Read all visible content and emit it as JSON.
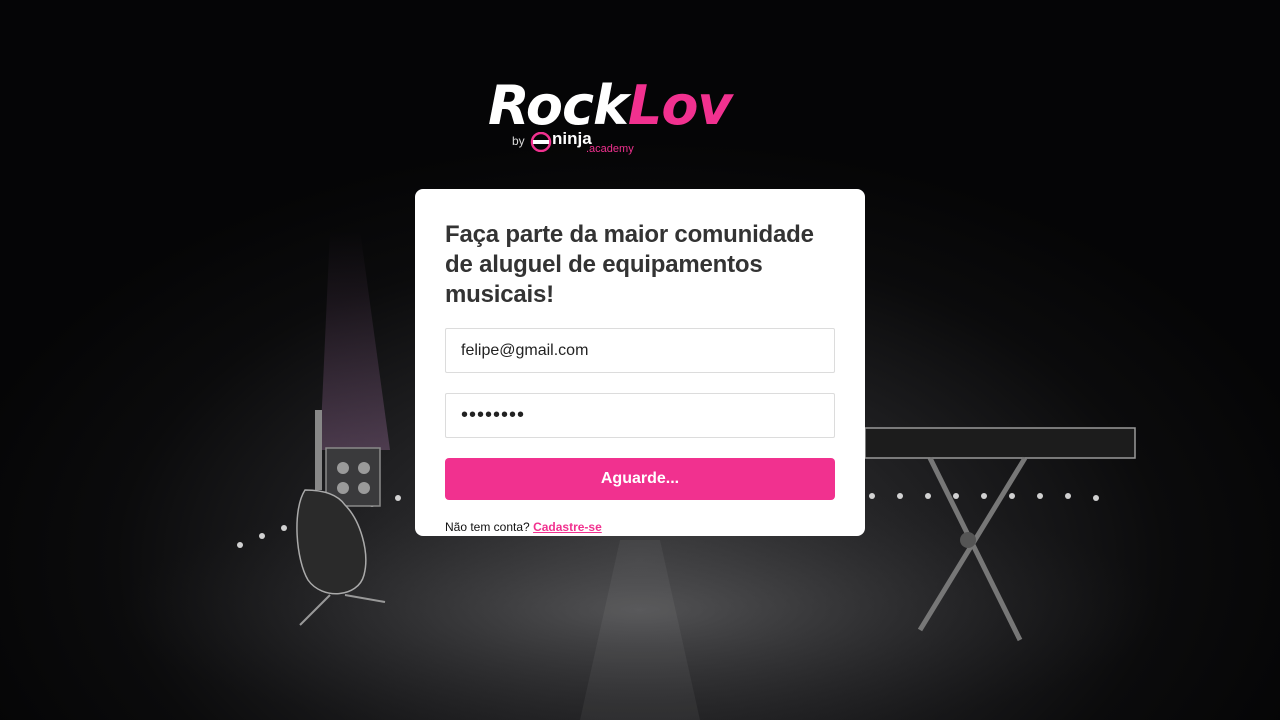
{
  "brand": {
    "logo_primary": "Rock",
    "logo_accent": "Lov",
    "by_text": "by",
    "partner_name": "ninja",
    "partner_suffix": ".academy",
    "accent_color": "#f1318f"
  },
  "login_form": {
    "headline": "Faça parte da maior comunidade de aluguel de equipamentos musicais!",
    "email_value": "felipe@gmail.com",
    "password_value": "pwd12345",
    "submit_label": "Aguarde...",
    "signup_prompt": "Não tem conta?",
    "signup_link_label": "Cadastre-se"
  },
  "icons": {
    "partner_logo": "ninja-mask-icon"
  }
}
